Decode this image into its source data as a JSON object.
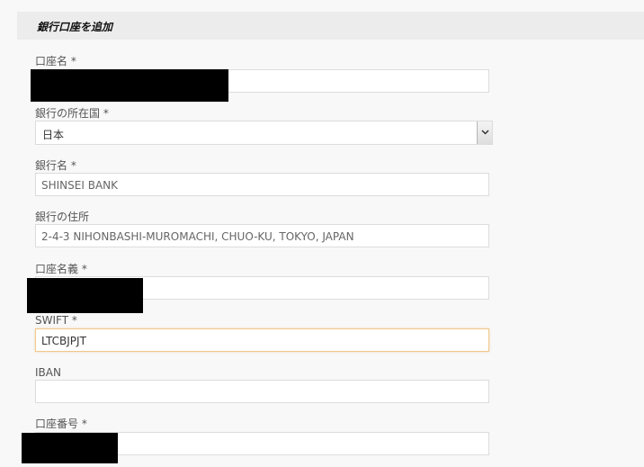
{
  "header": {
    "title": "銀行口座を追加"
  },
  "fields": {
    "account_name": {
      "label": "口座名 *",
      "value": ""
    },
    "bank_country": {
      "label": "銀行の所在国 *",
      "value": "日本"
    },
    "bank_name": {
      "label": "銀行名 *",
      "value": "SHINSEI BANK"
    },
    "bank_address": {
      "label": "銀行の住所",
      "value": "2-4-3 NIHONBASHI-MUROMACHI, CHUO-KU, TOKYO, JAPAN"
    },
    "account_holder": {
      "label": "口座名義 *",
      "value": ""
    },
    "swift": {
      "label": "SWIFT *",
      "value": "LTCBJPJT"
    },
    "iban": {
      "label": "IBAN",
      "value": ""
    },
    "account_number": {
      "label": "口座番号 *",
      "value": ""
    }
  },
  "icons": {
    "select_arrow": "chevron-down-icon"
  }
}
